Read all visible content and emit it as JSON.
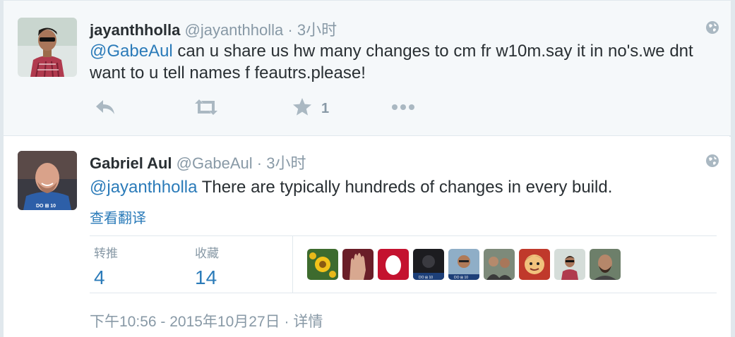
{
  "reply_tweet": {
    "fullname": "jayanthholla",
    "username": "@jayanthholla",
    "separator": "·",
    "time": "3小时",
    "mention": "@GabeAul",
    "text": " can u share us hw many changes to cm fr w10m.say it in no's.we dnt want to u tell names f feautrs.please!",
    "favorite_count": "1",
    "icons": [
      "reply-icon",
      "retweet-icon",
      "favorite-icon",
      "more-icon",
      "globe-icon"
    ]
  },
  "main_tweet": {
    "fullname": "Gabriel Aul",
    "username": "@GabeAul",
    "separator": "·",
    "time": "3小时",
    "mention": "@jayanthholla",
    "text": " There are typically hundreds of changes in every build.",
    "translate_label": "查看翻译",
    "retweets_label": "转推",
    "retweets_value": "4",
    "favorites_label": "收藏",
    "favorites_value": "14",
    "favoriter_avatars": [
      "flower",
      "hand",
      "red-egg",
      "dark-profile",
      "man-glasses",
      "people",
      "cartoon",
      "jayanthholla",
      "man-beard"
    ],
    "timestamp": "下午10:56 - 2015年10月27日",
    "meta_separator": "·",
    "details_label": "详情"
  },
  "colors": {
    "link": "#2b7bb9",
    "muted": "#8899a6",
    "text": "#292f33",
    "reply_bg": "#f5f8fa",
    "border": "#e1e8ed"
  }
}
